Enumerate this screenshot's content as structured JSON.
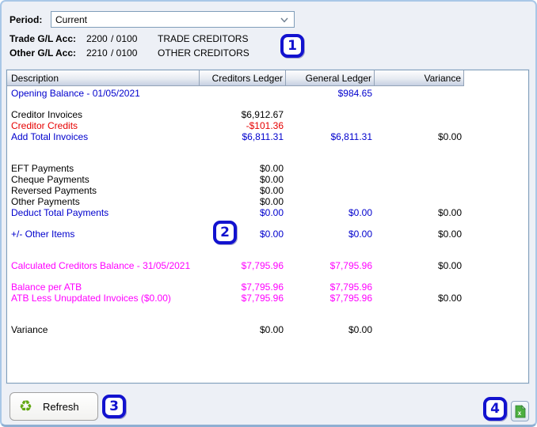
{
  "colors": {
    "blue": "#0000cd",
    "red": "#e60000",
    "magenta": "#ff00ff",
    "black": "#000000",
    "badge_blue": "#1212cf",
    "refresh_green": "#63a813",
    "excel_green": "#3d9b35"
  },
  "period": {
    "label": "Period:",
    "value": "Current"
  },
  "accounts": [
    {
      "label": "Trade G/L Acc:",
      "code": "2200",
      "sub_code": "/ 0100",
      "name": "TRADE CREDITORS"
    },
    {
      "label": "Other G/L Acc:",
      "code": "2210",
      "sub_code": "/ 0100",
      "name": "OTHER CREDITORS"
    }
  ],
  "table": {
    "columns": [
      "Description",
      "Creditors Ledger",
      "General Ledger",
      "Variance"
    ],
    "rows": [
      {
        "desc": "Opening Balance - 01/05/2021",
        "cl": "",
        "gl": "$984.65",
        "var": "",
        "color": "blue"
      },
      {
        "spacer": true
      },
      {
        "desc": "Creditor Invoices",
        "cl": "$6,912.67",
        "gl": "",
        "var": "",
        "color": "black"
      },
      {
        "desc": "Creditor Credits",
        "cl": "-$101.36",
        "gl": "",
        "var": "",
        "color": "red"
      },
      {
        "desc": "Add Total Invoices",
        "cl": "$6,811.31",
        "gl": "$6,811.31",
        "var": "$0.00",
        "color": "blue"
      },
      {
        "spacer": true
      },
      {
        "spacer": true
      },
      {
        "desc": "EFT Payments",
        "cl": "$0.00",
        "gl": "",
        "var": "",
        "color": "black"
      },
      {
        "desc": "Cheque Payments",
        "cl": "$0.00",
        "gl": "",
        "var": "",
        "color": "black"
      },
      {
        "desc": "Reversed Payments",
        "cl": "$0.00",
        "gl": "",
        "var": "",
        "color": "black"
      },
      {
        "desc": "Other Payments",
        "cl": "$0.00",
        "gl": "",
        "var": "",
        "color": "black"
      },
      {
        "desc": "Deduct Total Payments",
        "cl": "$0.00",
        "gl": "$0.00",
        "var": "$0.00",
        "color": "blue"
      },
      {
        "spacer": true
      },
      {
        "desc": "+/- Other Items",
        "cl": "$0.00",
        "gl": "$0.00",
        "var": "$0.00",
        "color": "blue"
      },
      {
        "spacer": true
      },
      {
        "spacer": true
      },
      {
        "desc": "Calculated Creditors Balance - 31/05/2021",
        "cl": "$7,795.96",
        "gl": "$7,795.96",
        "var": "$0.00",
        "color": "magenta"
      },
      {
        "spacer": true
      },
      {
        "desc": "Balance per ATB",
        "cl": "$7,795.96",
        "gl": "$7,795.96",
        "var": "",
        "color": "magenta"
      },
      {
        "desc": "ATB Less Unupdated Invoices ($0.00)",
        "cl": "$7,795.96",
        "gl": "$7,795.96",
        "var": "$0.00",
        "color": "magenta"
      },
      {
        "spacer": true
      },
      {
        "spacer": true
      },
      {
        "desc": "Variance",
        "cl": "$0.00",
        "gl": "$0.00",
        "var": "",
        "color": "black"
      }
    ]
  },
  "callouts": {
    "one": "1",
    "two": "2",
    "three": "3",
    "four": "4"
  },
  "footer": {
    "refresh_label": "Refresh",
    "refresh_icon": "recycle-icon",
    "export_icon": "excel-export-icon",
    "refresh_icon_glyph": "♻"
  }
}
